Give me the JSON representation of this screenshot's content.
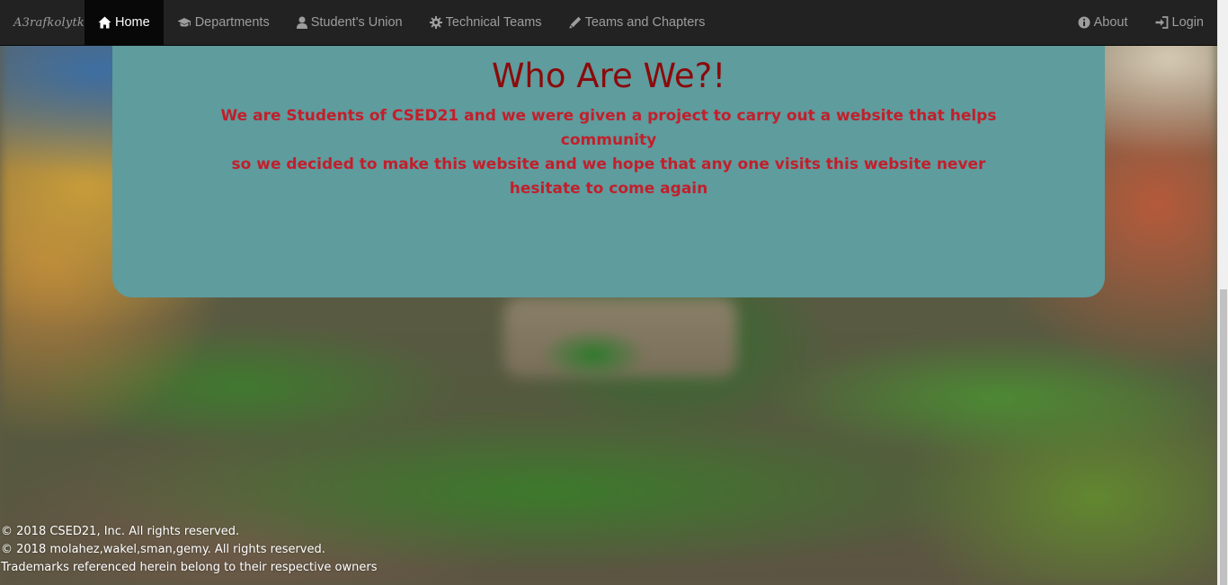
{
  "navbar": {
    "brand": "A3rafkolytk",
    "left_items": [
      {
        "label": "Home",
        "icon": "home-icon",
        "active": true
      },
      {
        "label": "Departments",
        "icon": "graduation-cap-icon",
        "active": false
      },
      {
        "label": "Student's Union",
        "icon": "user-icon",
        "active": false
      },
      {
        "label": "Technical Teams",
        "icon": "gear-icon",
        "active": false
      },
      {
        "label": "Teams and Chapters",
        "icon": "pencil-icon",
        "active": false
      }
    ],
    "right_items": [
      {
        "label": "About",
        "icon": "info-icon"
      },
      {
        "label": "Login",
        "icon": "login-icon"
      }
    ]
  },
  "main": {
    "title": "Who Are We?!",
    "paragraph_lines": [
      "We are Students of CSED21 and we were given a project to carry out a website that helps community",
      "so we decided to make this website and we hope that any one visits this website never hesitate to come again"
    ]
  },
  "footer": {
    "lines": [
      "© 2018 CSED21, Inc. All rights reserved.",
      "© 2018 molahez,wakel,sman,gemy. All rights reserved.",
      "Trademarks referenced herein belong to their respective owners"
    ]
  },
  "colors": {
    "navbar_bg": "#222222",
    "nav_text": "#9d9d9d",
    "nav_active_bg": "#080808",
    "card_bg": "#5e9c9e",
    "title_color": "#8b0a0a",
    "text_color": "#c21f2b"
  }
}
